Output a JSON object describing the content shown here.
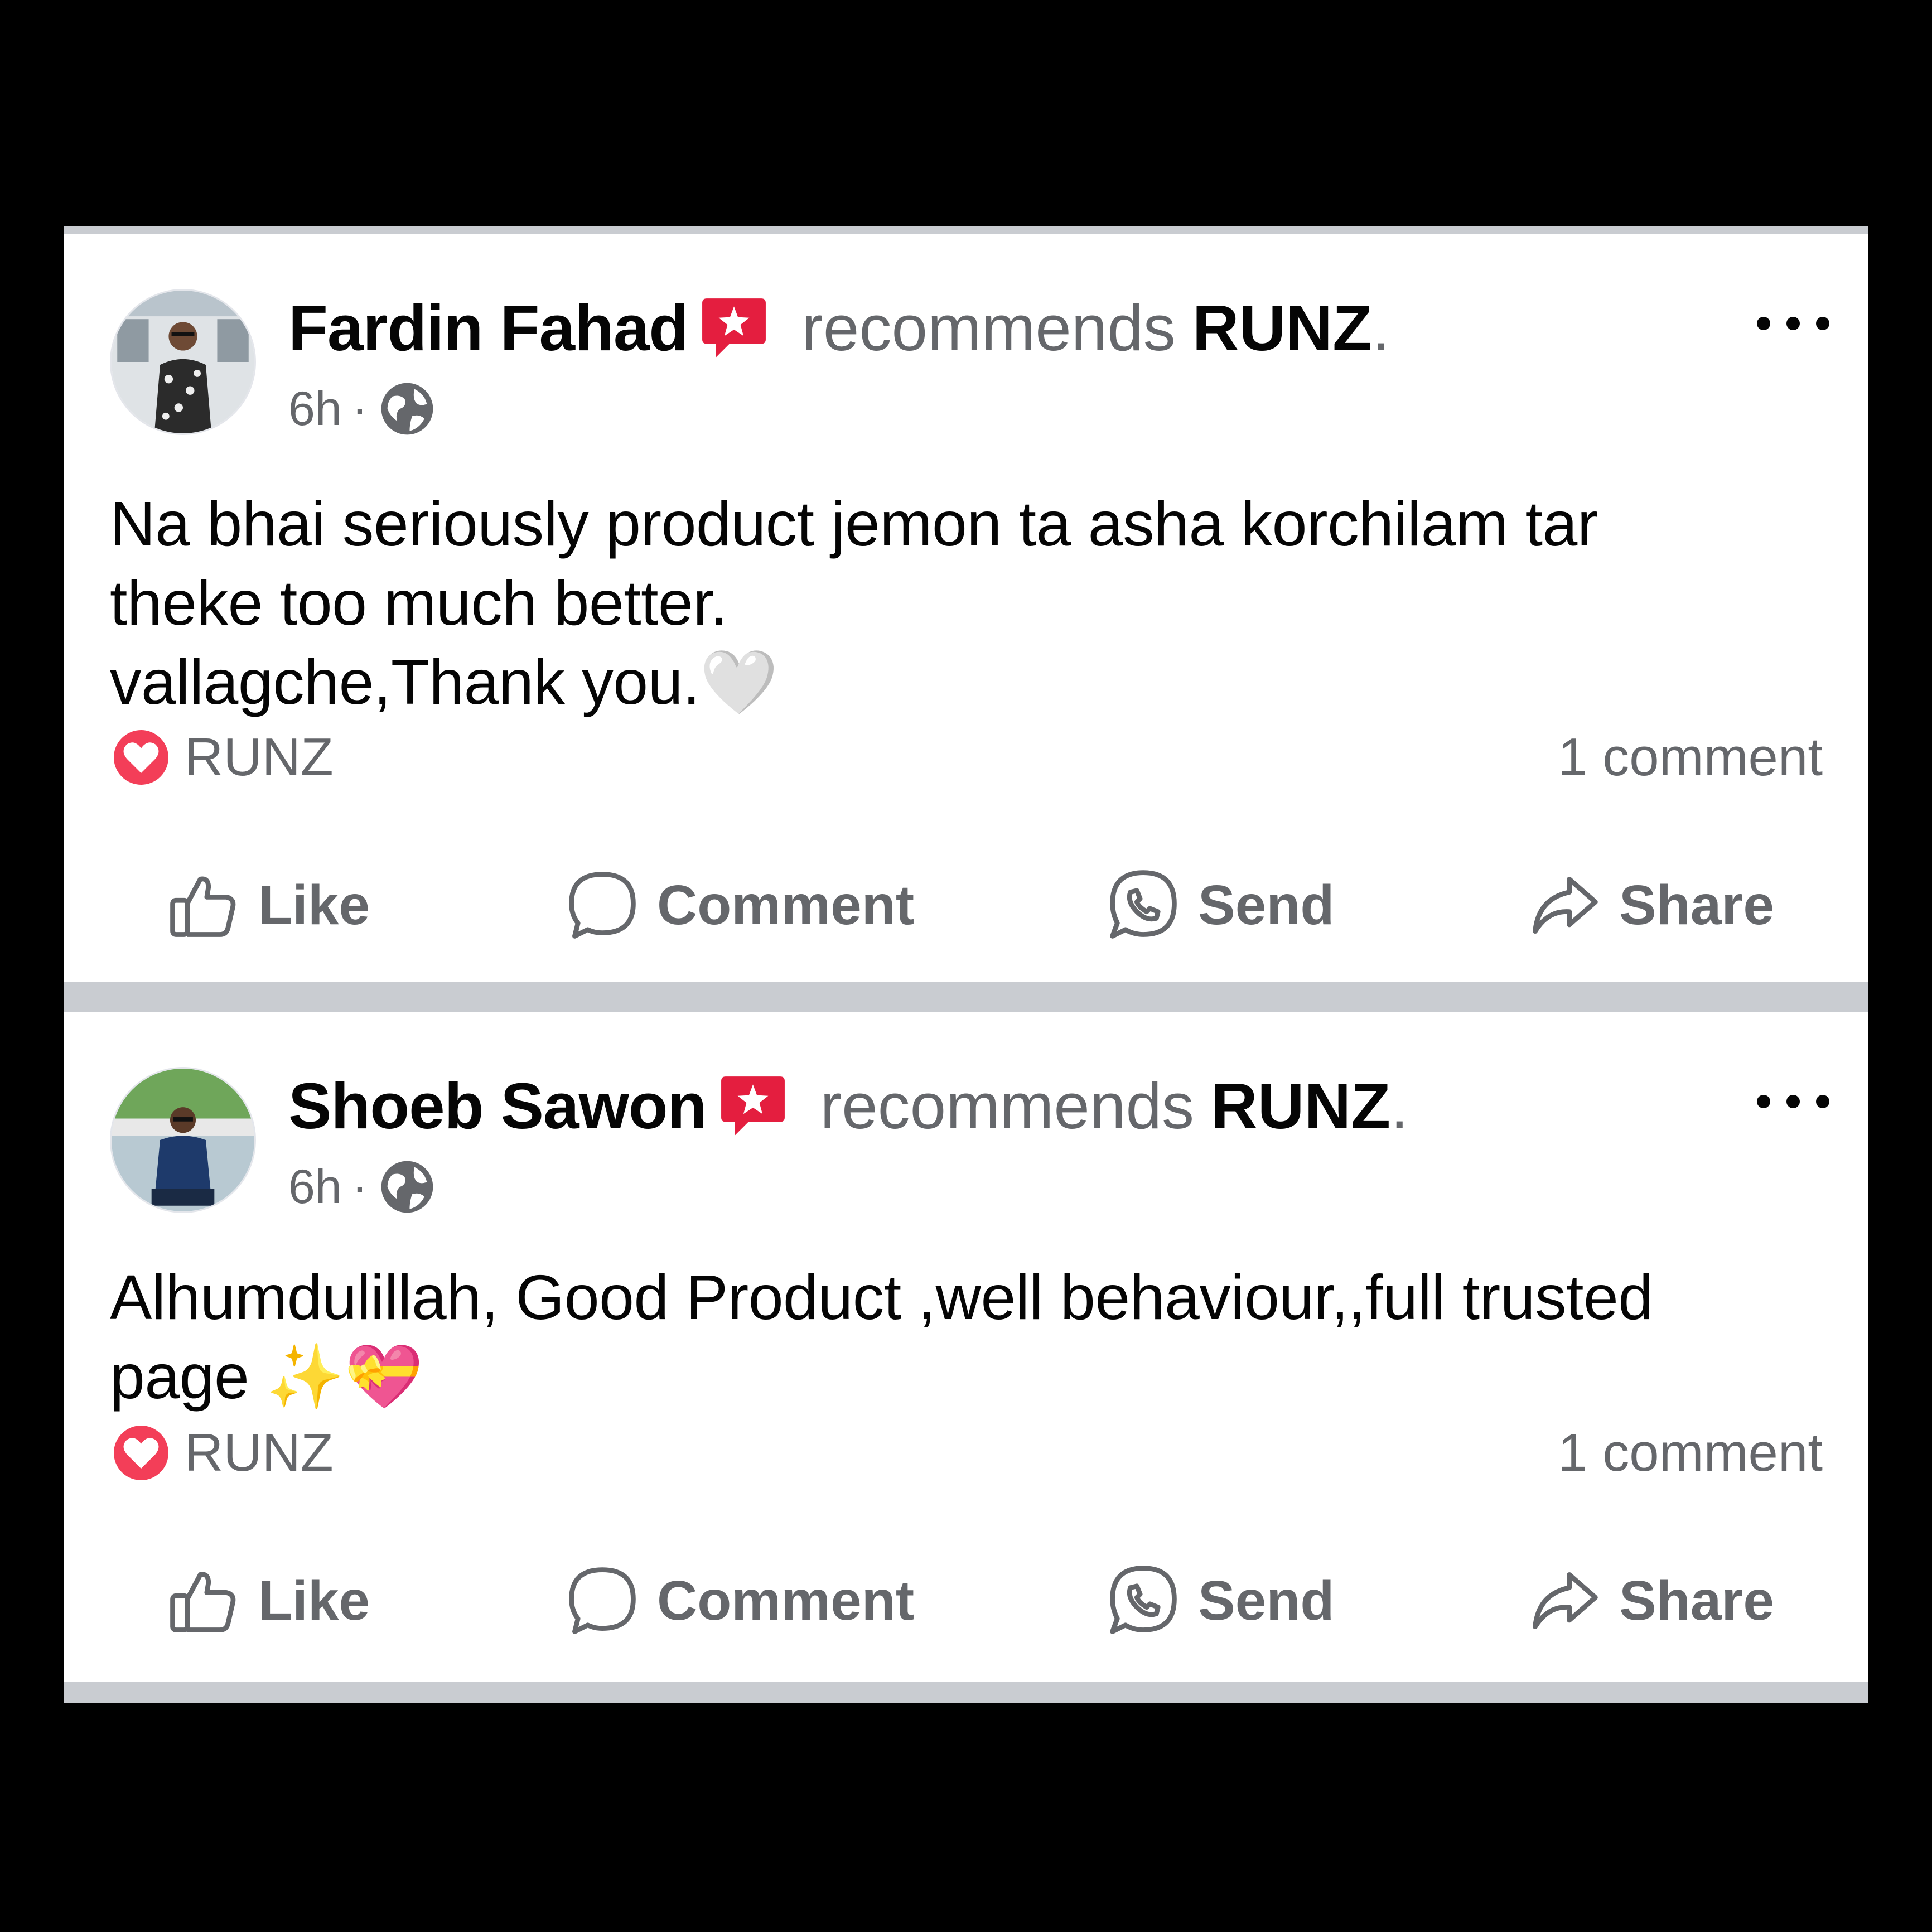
{
  "posts": [
    {
      "author": "Fardin Fahad",
      "recommends": "recommends",
      "page": "RUNZ",
      "period": ".",
      "time": "6h",
      "sep": "·",
      "text": "Na bhai seriously product jemon ta asha korchilam tar\ntheke too much better.\nvallagche,Thank you.🤍",
      "reaction_label": "RUNZ",
      "comments": "1 comment"
    },
    {
      "author": "Shoeb Sawon",
      "recommends": "recommends",
      "page": "RUNZ",
      "period": ".",
      "time": "6h",
      "sep": "·",
      "text": "Alhumdulillah, Good Product ,well behaviour,,full trusted\npage ✨💝",
      "reaction_label": "RUNZ",
      "comments": "1 comment"
    }
  ],
  "actions": {
    "like": "Like",
    "comment": "Comment",
    "send": "Send",
    "share": "Share"
  },
  "colors": {
    "recommend_badge": "#e41e3f",
    "secondary_text": "#65676b",
    "primary_text": "#050505",
    "feed_divider": "#c9ccd1"
  },
  "icons": [
    "recommend-badge-icon",
    "globe-icon",
    "more-options-icon",
    "heart-reaction-icon",
    "like-icon",
    "comment-icon",
    "send-icon",
    "share-icon"
  ]
}
